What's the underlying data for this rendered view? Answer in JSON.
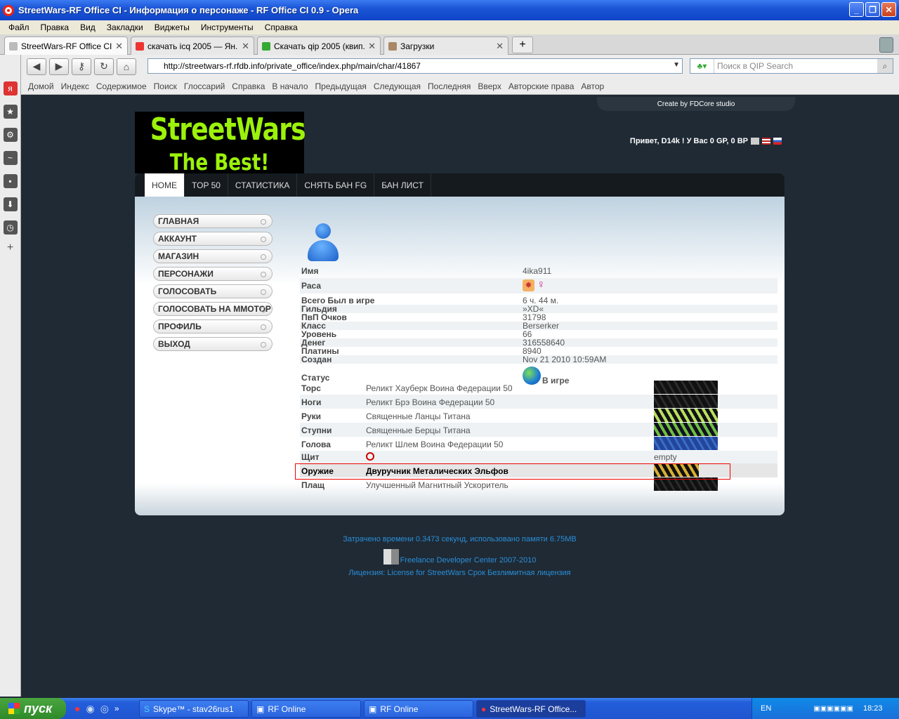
{
  "window": {
    "title": "StreetWars-RF Office CI - Информация о персонаже - RF Office CI 0.9 - Opera"
  },
  "menu": [
    "Файл",
    "Правка",
    "Вид",
    "Закладки",
    "Виджеты",
    "Инструменты",
    "Справка"
  ],
  "tabs": [
    {
      "label": "StreetWars-RF Office CI...",
      "icon": "opera-page-icon",
      "active": true
    },
    {
      "label": "скачать icq 2005 — Ян...",
      "icon": "yandex-icon",
      "active": false
    },
    {
      "label": "Скачать qip 2005 (квип...",
      "icon": "qip-icon",
      "active": false
    },
    {
      "label": "Загрузки",
      "icon": "downloads-icon",
      "active": false
    }
  ],
  "address": {
    "url": "http://streetwars-rf.rfdb.info/private_office/index.php/main/char/41867",
    "search_placeholder": "Поиск в QIP Search"
  },
  "navlinks": [
    "Домой",
    "Индекс",
    "Содержимое",
    "Поиск",
    "Глоссарий",
    "Справка",
    "В начало",
    "Предыдущая",
    "Следующая",
    "Последняя",
    "Вверх",
    "Авторские права",
    "Автор"
  ],
  "site": {
    "createby": "Create by FDCore studio",
    "banner_line1": "StreetWars",
    "banner_line2": "The Best!",
    "greeting": "Привет, D14k ! У Вас 0 GP, 0 BP",
    "topnav": [
      "HOME",
      "TOP 50",
      "СТАТИСТИКА",
      "СНЯТЬ БАН FG",
      "БАН ЛИСТ"
    ],
    "leftmenu": [
      "ГЛАВНАЯ",
      "АККАУНТ",
      "МАГАЗИН",
      "ПЕРСОНАЖИ",
      "ГОЛОСОВАТЬ",
      "ГОЛОСОВАТЬ НА ММОТОР",
      "ПРОФИЛЬ",
      "ВЫХОД"
    ]
  },
  "character": {
    "rows": [
      {
        "k": "Имя",
        "v": "4ika911"
      },
      {
        "k": "Раса",
        "v": ""
      },
      {
        "k": "Всего Был в игре",
        "v": "6 ч. 44 м."
      },
      {
        "k": "Гильдия",
        "v": "»XD«"
      },
      {
        "k": "ПвП Очков",
        "v": "31798"
      },
      {
        "k": "Класс",
        "v": "Berserker"
      },
      {
        "k": "Уровень",
        "v": "66"
      },
      {
        "k": "Денег",
        "v": "316558640"
      },
      {
        "k": "Платины",
        "v": "8940"
      },
      {
        "k": "Создан",
        "v": "Nov 21 2010 10:59AM"
      }
    ],
    "status_label": "Статус",
    "status_value": "В игре"
  },
  "equipment": [
    {
      "slot": "Торс",
      "item": "Реликт Хауберк Воина Федерации 50"
    },
    {
      "slot": "Ноги",
      "item": "Реликт Брэ Воина Федерации 50"
    },
    {
      "slot": "Руки",
      "item": "Священные Ланцы Титана"
    },
    {
      "slot": "Ступни",
      "item": "Священные Берцы Титана"
    },
    {
      "slot": "Голова",
      "item": "Реликт Шлем Воина Федерации 50"
    },
    {
      "slot": "Щит",
      "item": "",
      "extra": "empty"
    },
    {
      "slot": "Оружие",
      "item": "Двуручник Металических Эльфов"
    },
    {
      "slot": "Плащ",
      "item": "Улучшенный Магнитный Ускоритель"
    }
  ],
  "footer": {
    "time": "Затрачено времени 0.3473 секунд, использовано памяти 6.75MB",
    "dev": "Freelance Developer Center 2007-2010",
    "license": "Лицензия: License for StreetWars Срок Безлимитная лицензия"
  },
  "taskbar": {
    "start": "пуск",
    "tasks": [
      "Skype™ - stav26rus1",
      "RF Online",
      "RF Online",
      "StreetWars-RF Office..."
    ],
    "lang": "EN",
    "clock": "18:23"
  }
}
